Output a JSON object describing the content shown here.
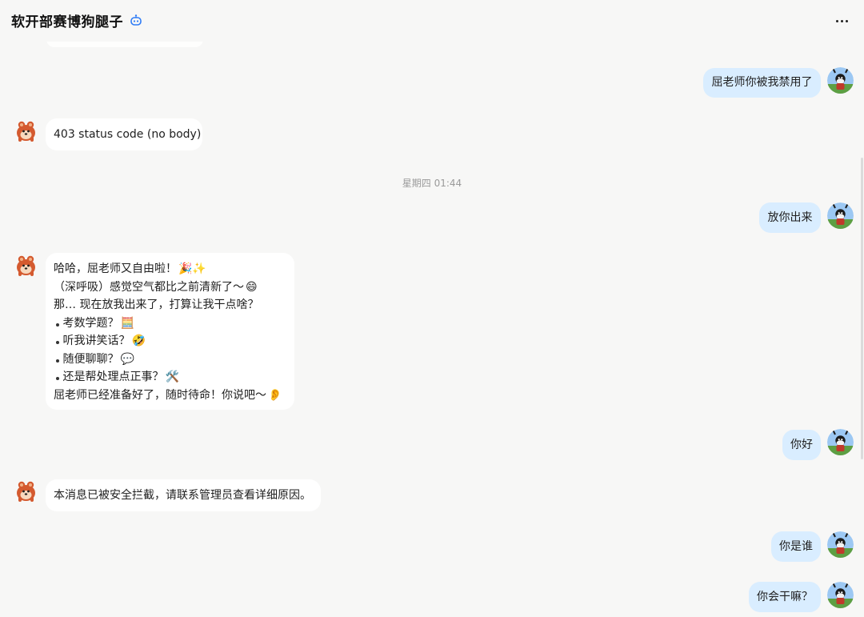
{
  "app": {
    "title": "软开部赛博狗腿子"
  },
  "timestamp": "星期四 01:44",
  "messages": {
    "u1": "屈老师你被我禁用了",
    "b1": "403 status code (no body)",
    "u2": "放你出来",
    "b2": {
      "line1_text": "哈哈，屈老师又自由啦！",
      "line1_emoji": "🎉✨",
      "line2_text": "（深呼吸）感觉空气都比之前清新了～",
      "line2_emoji": "😄",
      "line3_text": "那… 现在放我出来了，打算让我干点啥？",
      "bullet1_text": "考数学题？",
      "bullet1_emoji": "🧮",
      "bullet2_text": "听我讲笑话？",
      "bullet2_emoji": "🤣",
      "bullet3_text": "随便聊聊？",
      "bullet3_emoji": "💬",
      "bullet4_text": "还是帮处理点正事？",
      "bullet4_emoji": "🛠️",
      "line4_text": "屈老师已经准备好了，随时待命！你说吧～",
      "line4_emoji": "👂"
    },
    "u3": "你好",
    "b3": "本消息已被安全拦截，请联系管理员查看详细原因。",
    "u4": "你是谁",
    "u5": "你会干嘛？"
  },
  "icons": {
    "bot_icon": "robot-icon",
    "more_icon": "more-icon",
    "bot_avatar": "bot-avatar-icon",
    "user_avatar": "user-avatar-icon"
  },
  "colors": {
    "background": "#f7f7f6",
    "user_bubble": "#d9edff",
    "bot_bubble": "#ffffff",
    "accent": "#2f7cf6"
  }
}
